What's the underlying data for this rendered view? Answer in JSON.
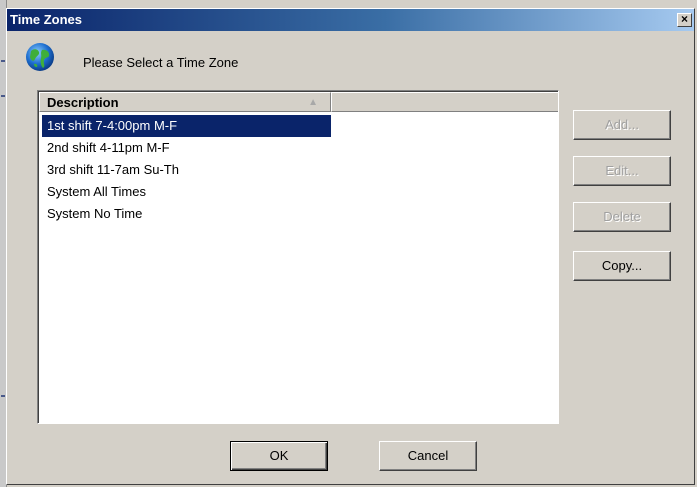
{
  "window": {
    "title": "Time Zones",
    "close_glyph": "×"
  },
  "header": {
    "icon": "globe-icon",
    "prompt": "Please Select a Time Zone"
  },
  "list": {
    "column_header": "Description",
    "sort_indicator": "▲",
    "rows": [
      {
        "label": "1st shift 7-4:00pm M-F",
        "selected": true
      },
      {
        "label": "2nd shift 4-11pm M-F",
        "selected": false
      },
      {
        "label": "3rd shift 11-7am Su-Th",
        "selected": false
      },
      {
        "label": "System All Times",
        "selected": false
      },
      {
        "label": "System No Time",
        "selected": false
      }
    ]
  },
  "side_buttons": {
    "add": "Add...",
    "edit": "Edit...",
    "delete": "Delete",
    "copy": "Copy..."
  },
  "footer_buttons": {
    "ok": "OK",
    "cancel": "Cancel"
  },
  "colors": {
    "selection": "#0a246a",
    "titlebar_start": "#0a246a",
    "titlebar_end": "#a6caf0",
    "dialog_face": "#d4d0c8"
  }
}
